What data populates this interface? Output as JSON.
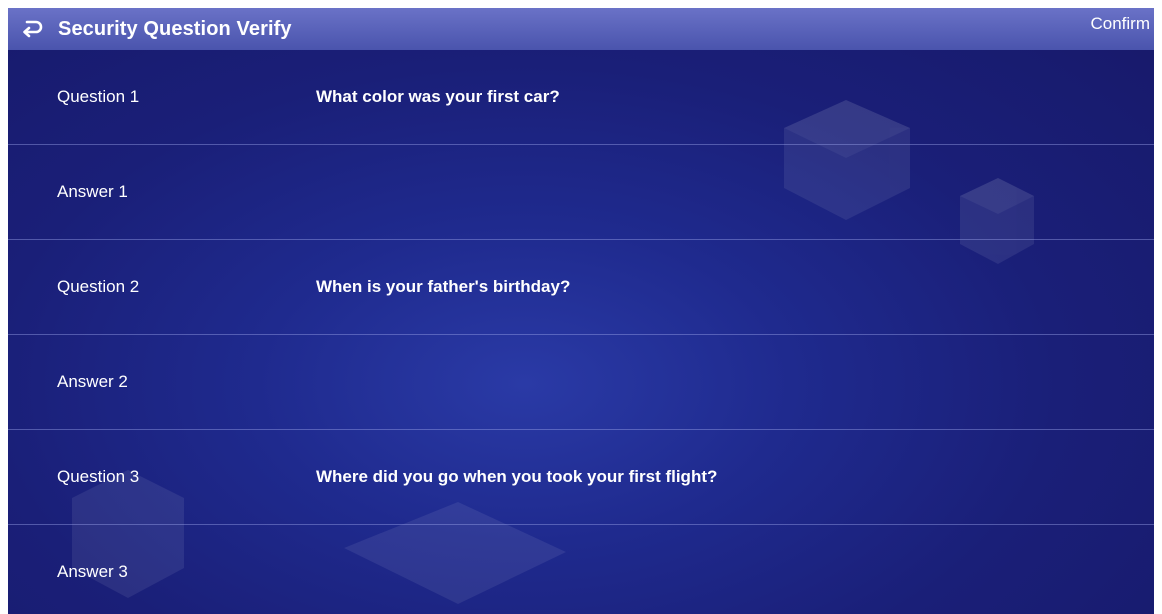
{
  "header": {
    "title": "Security Question Verify",
    "confirm_label": "Confirm",
    "back_icon": "return-arrow-icon"
  },
  "rows": [
    {
      "label": "Question 1",
      "value": "What color was your first car?"
    },
    {
      "label": "Answer 1",
      "value": ""
    },
    {
      "label": "Question 2",
      "value": "When is your father's birthday?"
    },
    {
      "label": "Answer 2",
      "value": ""
    },
    {
      "label": "Question 3",
      "value": "Where did you go when you took your first flight?"
    },
    {
      "label": "Answer 3",
      "value": ""
    }
  ],
  "colors": {
    "background": "#1a1f78",
    "header": "#5a63ba",
    "text": "#ffffff",
    "divider": "#7d86d6"
  }
}
